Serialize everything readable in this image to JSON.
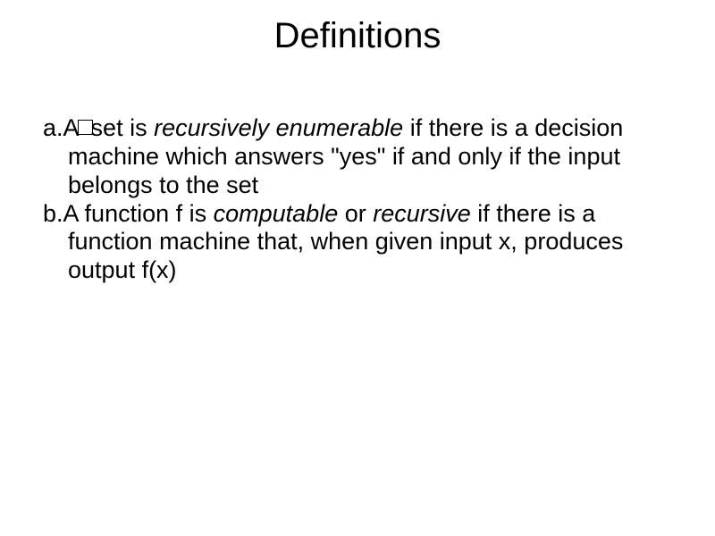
{
  "title": "Definitions",
  "defs": {
    "a": {
      "label": "a.",
      "pre_box": "A",
      "t1": "set is ",
      "term1": "recursively enumerable",
      "t2": " if there is a decision machine which answers \"yes\" if and only if the input belongs to the set"
    },
    "b": {
      "label": "b.",
      "t1": "A function f is ",
      "term1": "computable",
      "t2": " or ",
      "term2": "recursive",
      "t3": " if there is a function machine that, when given input x, produces output f(x)"
    }
  }
}
